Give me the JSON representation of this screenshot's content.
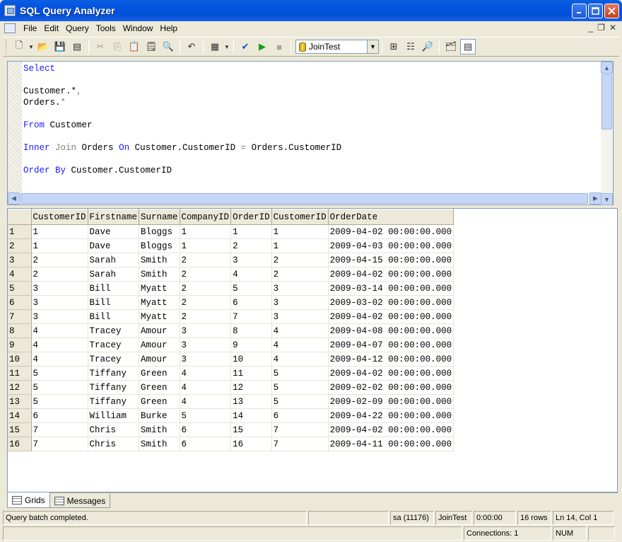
{
  "window": {
    "title": "SQL Query Analyzer"
  },
  "menu": [
    "File",
    "Edit",
    "Query",
    "Tools",
    "Window",
    "Help"
  ],
  "toolbar": {
    "database": "JoinTest"
  },
  "editor": {
    "lines": [
      [
        {
          "t": "Select",
          "c": "kw"
        }
      ],
      [],
      [
        {
          "t": "Customer.*",
          "c": ""
        },
        {
          "t": ",",
          "c": "gray"
        }
      ],
      [
        {
          "t": "Orders.",
          "c": ""
        },
        {
          "t": "*",
          "c": "gray"
        }
      ],
      [],
      [
        {
          "t": "From",
          "c": "kw"
        },
        {
          "t": " Customer",
          "c": ""
        }
      ],
      [],
      [
        {
          "t": "Inner",
          "c": "kw"
        },
        {
          "t": " ",
          "c": ""
        },
        {
          "t": "Join",
          "c": "gray"
        },
        {
          "t": " Orders ",
          "c": ""
        },
        {
          "t": "On",
          "c": "kw"
        },
        {
          "t": " Customer.CustomerID ",
          "c": ""
        },
        {
          "t": "=",
          "c": "gray"
        },
        {
          "t": " Orders.CustomerID",
          "c": ""
        }
      ],
      [],
      [
        {
          "t": "Order By",
          "c": "kw"
        },
        {
          "t": " Customer.CustomerID",
          "c": ""
        }
      ]
    ]
  },
  "grid": {
    "columns": [
      "CustomerID",
      "Firstname",
      "Surname",
      "CompanyID",
      "OrderID",
      "CustomerID",
      "OrderDate"
    ],
    "rows": [
      [
        "1",
        "1",
        "Dave",
        "Bloggs",
        "1",
        "1",
        "1",
        "2009-04-02 00:00:00.000"
      ],
      [
        "2",
        "1",
        "Dave",
        "Bloggs",
        "1",
        "2",
        "1",
        "2009-04-03 00:00:00.000"
      ],
      [
        "3",
        "2",
        "Sarah",
        "Smith",
        "2",
        "3",
        "2",
        "2009-04-15 00:00:00.000"
      ],
      [
        "4",
        "2",
        "Sarah",
        "Smith",
        "2",
        "4",
        "2",
        "2009-04-02 00:00:00.000"
      ],
      [
        "5",
        "3",
        "Bill",
        "Myatt",
        "2",
        "5",
        "3",
        "2009-03-14 00:00:00.000"
      ],
      [
        "6",
        "3",
        "Bill",
        "Myatt",
        "2",
        "6",
        "3",
        "2009-03-02 00:00:00.000"
      ],
      [
        "7",
        "3",
        "Bill",
        "Myatt",
        "2",
        "7",
        "3",
        "2009-04-02 00:00:00.000"
      ],
      [
        "8",
        "4",
        "Tracey",
        "Amour",
        "3",
        "8",
        "4",
        "2009-04-08 00:00:00.000"
      ],
      [
        "9",
        "4",
        "Tracey",
        "Amour",
        "3",
        "9",
        "4",
        "2009-04-07 00:00:00.000"
      ],
      [
        "10",
        "4",
        "Tracey",
        "Amour",
        "3",
        "10",
        "4",
        "2009-04-12 00:00:00.000"
      ],
      [
        "11",
        "5",
        "Tiffany",
        "Green",
        "4",
        "11",
        "5",
        "2009-04-02 00:00:00.000"
      ],
      [
        "12",
        "5",
        "Tiffany",
        "Green",
        "4",
        "12",
        "5",
        "2009-02-02 00:00:00.000"
      ],
      [
        "13",
        "5",
        "Tiffany",
        "Green",
        "4",
        "13",
        "5",
        "2009-02-09 00:00:00.000"
      ],
      [
        "14",
        "6",
        "William",
        "Burke",
        "5",
        "14",
        "6",
        "2009-04-22 00:00:00.000"
      ],
      [
        "15",
        "7",
        "Chris",
        "Smith",
        "6",
        "15",
        "7",
        "2009-04-02 00:00:00.000"
      ],
      [
        "16",
        "7",
        "Chris",
        "Smith",
        "6",
        "16",
        "7",
        "2009-04-11 00:00:00.000"
      ]
    ]
  },
  "tabs": {
    "grids": "Grids",
    "messages": "Messages"
  },
  "status": {
    "message": "Query batch completed.",
    "user": "sa (11176)",
    "db": "JoinTest",
    "time": "0:00:00",
    "rows": "16 rows",
    "position": "Ln 14, Col 1",
    "connections": "Connections: 1",
    "num": "NUM"
  }
}
